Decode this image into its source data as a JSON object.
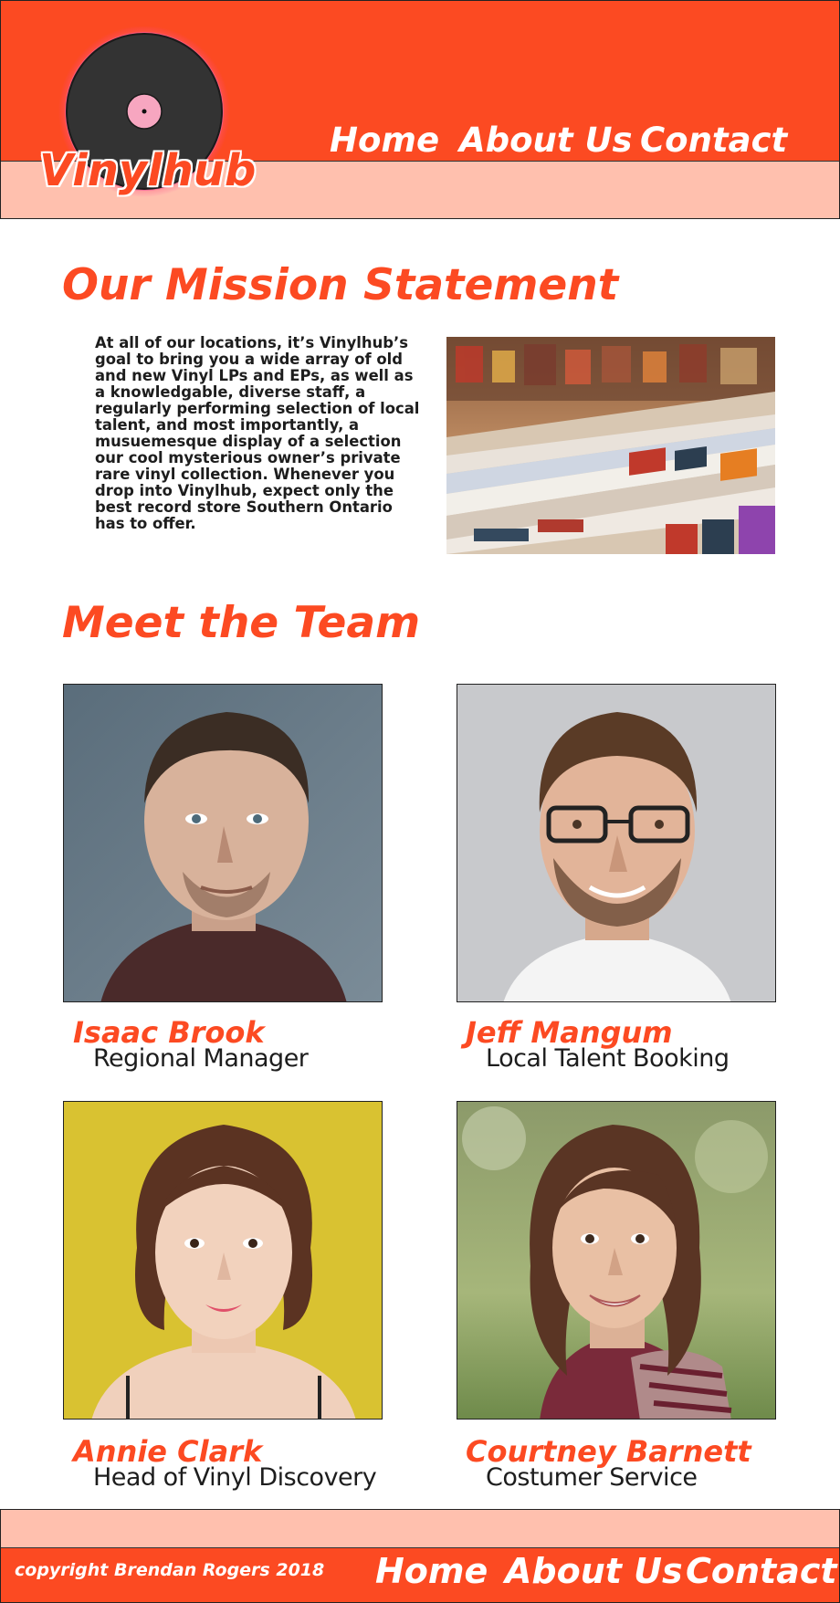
{
  "brand": {
    "name": "Vinylhub",
    "primary_color": "#fc4a22",
    "light_color": "#ffc0ae",
    "icon": "vinyl-record-icon"
  },
  "nav": {
    "home": "Home",
    "about": "About Us",
    "contact": "Contact"
  },
  "mission": {
    "heading": "Our Mission Statement",
    "text": "At all of our locations, it’s Vinylhub’s goal to bring you a wide array of old and new Vinyl LPs and EPs, as well as a knowledgable, diverse staff, a regularly performing selection of local talent, and most importantly, a musuemesque display of a selection our cool mysterious owner’s private rare vinyl collection. Whenever you drop into Vinylhub, expect only the best record store Southern Ontario has to offer."
  },
  "team": {
    "heading": "Meet the Team",
    "members": [
      {
        "name": "Isaac Brook",
        "role": "Regional Manager"
      },
      {
        "name": "Jeff Mangum",
        "role": "Local Talent Booking"
      },
      {
        "name": "Annie Clark",
        "role": "Head of Vinyl Discovery"
      },
      {
        "name": "Courtney Barnett",
        "role": "Costumer Service"
      }
    ]
  },
  "footer": {
    "copyright": "copyright Brendan Rogers 2018",
    "home": "Home",
    "about": "About Us",
    "contact": "Contact"
  }
}
